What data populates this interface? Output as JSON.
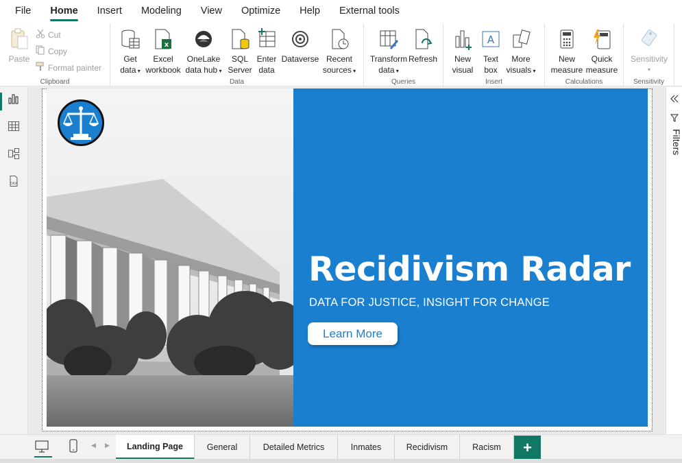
{
  "menu": {
    "items": [
      "File",
      "Home",
      "Insert",
      "Modeling",
      "View",
      "Optimize",
      "Help",
      "External tools"
    ]
  },
  "ribbon": {
    "clipboard": {
      "label": "Clipboard",
      "paste": "Paste",
      "cut": "Cut",
      "copy": "Copy",
      "format_painter": "Format painter"
    },
    "data": {
      "label": "Data",
      "get_data": [
        "Get",
        "data"
      ],
      "excel": [
        "Excel",
        "workbook"
      ],
      "onelake": [
        "OneLake",
        "data hub"
      ],
      "sql": [
        "SQL",
        "Server"
      ],
      "enter": [
        "Enter",
        "data"
      ],
      "dataverse": "Dataverse",
      "recent": [
        "Recent",
        "sources"
      ]
    },
    "queries": {
      "label": "Queries",
      "transform": [
        "Transform",
        "data"
      ],
      "refresh": "Refresh"
    },
    "insert": {
      "label": "Insert",
      "new_visual": [
        "New",
        "visual"
      ],
      "text_box": [
        "Text",
        "box"
      ],
      "more_visuals": [
        "More",
        "visuals"
      ]
    },
    "calculations": {
      "label": "Calculations",
      "new_measure": [
        "New",
        "measure"
      ],
      "quick_measure": [
        "Quick",
        "measure"
      ]
    },
    "sensitivity": {
      "label": "Sensitivity",
      "button": "Sensitivity"
    }
  },
  "report": {
    "title": "Recidivism Radar",
    "subtitle": "DATA FOR JUSTICE, INSIGHT FOR CHANGE",
    "button": "Learn More",
    "panel_color": "#1a7fcf"
  },
  "filters_pane": {
    "label": "Filters"
  },
  "tabs": {
    "pages": [
      "Landing Page",
      "General",
      "Detailed Metrics",
      "Inmates",
      "Recidivism",
      "Racism"
    ],
    "active_index": 0,
    "add_label": "+"
  },
  "accent": "#117865"
}
